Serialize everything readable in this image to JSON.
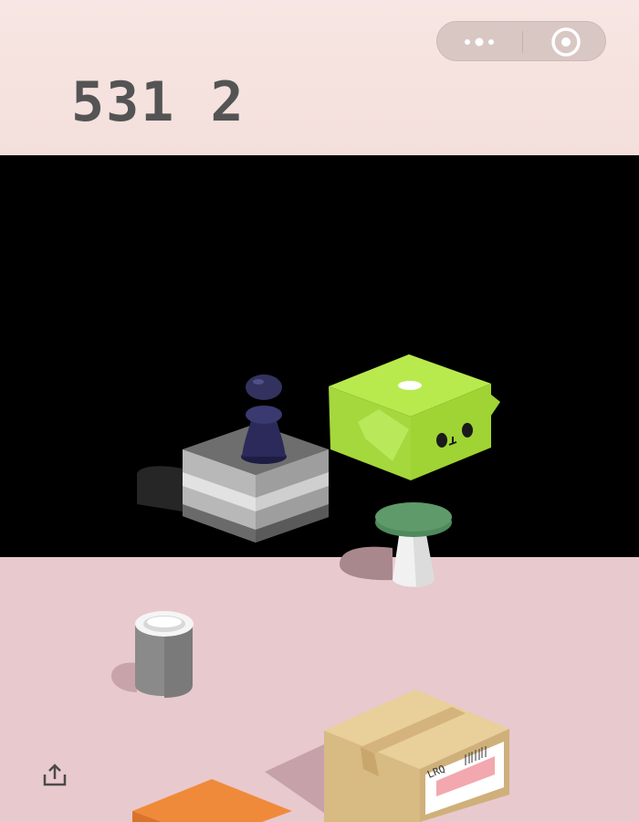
{
  "hud": {
    "score": "531 2"
  },
  "icons": {
    "menu": "more-dots-icon",
    "close": "target-circle-icon",
    "share": "share-upload-icon"
  },
  "colors": {
    "background_top": "#f5e3df",
    "background_bottom": "#e8c9ce",
    "score_text": "#545454",
    "green_box": "#b4e64a",
    "player_piece": "#2b2a5a",
    "orange_block": "#f08a3b",
    "green_stool": "#5f9a6a"
  },
  "label_text": {
    "carton_label": "LRQ"
  }
}
